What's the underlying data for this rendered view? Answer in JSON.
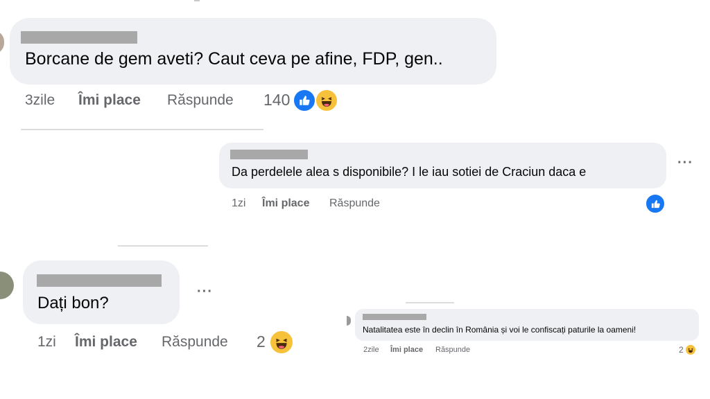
{
  "comments": [
    {
      "text": "Borcane de gem aveti? Caut ceva pe afine, FDP, gen..",
      "time": "3zile",
      "like_label": "Îmi place",
      "reply_label": "Răspunde",
      "reaction_count": "140",
      "reactions": [
        "like-icon",
        "haha-icon"
      ]
    },
    {
      "text": "Da perdelele alea s disponibile? I le iau sotiei de Craciun daca e",
      "time": "1zi",
      "like_label": "Îmi place",
      "reply_label": "Răspunde",
      "reactions": [
        "like-icon"
      ],
      "more": "···"
    },
    {
      "text": "Dați bon?",
      "time": "1zi",
      "like_label": "Îmi place",
      "reply_label": "Răspunde",
      "reaction_count": "2",
      "reactions": [
        "haha-icon"
      ],
      "more": "···"
    },
    {
      "text": "Natalitatea este în declin în România și voi le confiscați paturile la oameni!",
      "time": "2zile",
      "like_label": "Îmi place",
      "reply_label": "Răspunde",
      "reaction_count": "2",
      "reactions": [
        "haha-icon"
      ]
    }
  ],
  "colors": {
    "bubble": "#eef0f3",
    "meta": "#65676b",
    "like": "#1877f2",
    "haha": "#f7c23b"
  }
}
